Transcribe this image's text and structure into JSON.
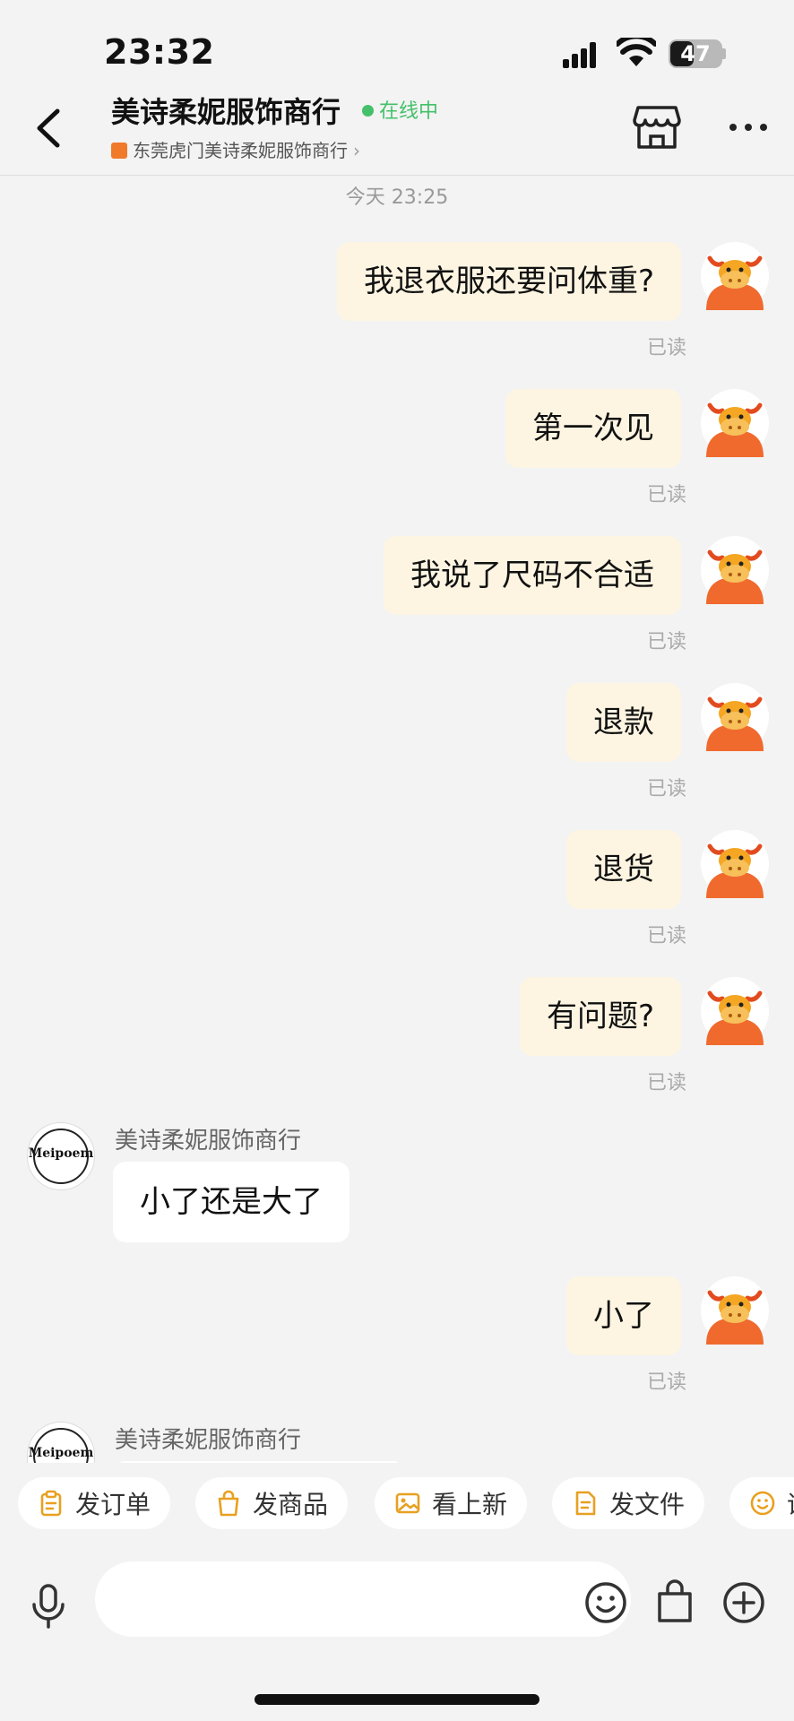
{
  "status_bar": {
    "time": "23:32",
    "battery": "47",
    "battery_level": 0.47
  },
  "header": {
    "shop_name": "美诗柔妮服饰商行",
    "online_status": "在线中",
    "sub_shop": "东莞虎门美诗柔妮服饰商行"
  },
  "chat": {
    "timestamp": "今天 23:25",
    "read_label": "已读",
    "sender_name": "美诗柔妮服饰商行",
    "shop_logo": "Meipoem",
    "messages": [
      {
        "side": "out",
        "text": "我退衣服还要问体重?"
      },
      {
        "side": "out",
        "text": "第一次见"
      },
      {
        "side": "out",
        "text": "我说了尺码不合适"
      },
      {
        "side": "out",
        "text": "退款"
      },
      {
        "side": "out",
        "text": "退货"
      },
      {
        "side": "out",
        "text": "有问题?"
      },
      {
        "side": "in",
        "text": "小了还是大了"
      },
      {
        "side": "out",
        "text": "小了"
      },
      {
        "side": "in",
        "text": ""
      }
    ]
  },
  "quick_actions": [
    {
      "label": "发订单",
      "icon": "clipboard-icon"
    },
    {
      "label": "发商品",
      "icon": "shopping-bag-icon"
    },
    {
      "label": "看上新",
      "icon": "image-icon"
    },
    {
      "label": "发文件",
      "icon": "file-icon"
    },
    {
      "label": "评",
      "icon": "smile-icon"
    }
  ],
  "input": {
    "placeholder": ""
  },
  "colors": {
    "accent_online": "#45c06a",
    "bubble_out": "#fdf5e2",
    "bubble_in": "#ffffff",
    "background": "#f3f3f3"
  }
}
